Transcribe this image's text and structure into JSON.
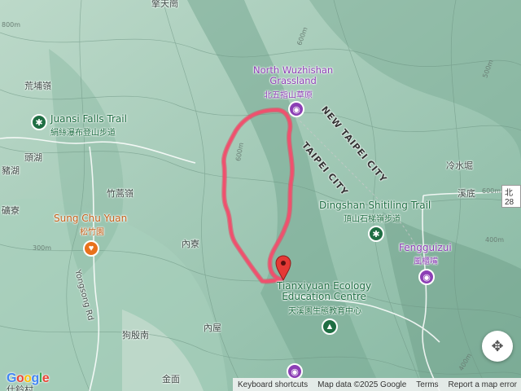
{
  "map": {
    "labels": {
      "top_place": "擎天崗",
      "huangpuling": "荒埔嶺",
      "toohu": "頭湖",
      "zhuhu": "豬湖",
      "lanliao": "礦寮",
      "zhugaoling": "竹蒿嶺",
      "neiliao": "內寮",
      "neiwu": "內屋",
      "gouyinan": "狗殷南",
      "jinmian": "金面",
      "lengshuikeng": "冷水堀",
      "xidi": "溪底",
      "yongsong_rd": "Yongsong Rd",
      "bottom_left": "仕鈴村"
    },
    "districts": {
      "new_taipei": "NEW TAIPEI CITY",
      "taipei": "TAIPEI CITY"
    },
    "pois": {
      "north_wuzhishan": {
        "en1": "North Wuzhishan",
        "en2": "Grassland",
        "zh": "北五指山草原",
        "icon": "camera-icon",
        "color": "#8c3fb5"
      },
      "juansi_falls": {
        "en": "Juansi Falls Trail",
        "zh": "絹絲瀑布登山步道",
        "icon": "hiker-icon",
        "color": "#1f6e43"
      },
      "sung_chu_yuan": {
        "en": "Sung Chu Yuan",
        "zh": "松竹園",
        "icon": "restaurant-icon",
        "color": "#c4611a"
      },
      "dingshan": {
        "en": "Dingshan Shitiling Trail",
        "zh": "頂山石梯嶺步道",
        "icon": "hiker-icon",
        "color": "#1f6e43"
      },
      "fengguizui": {
        "en": "Fengguizui",
        "zh": "風櫃嘴",
        "icon": "camera-icon",
        "color": "#8c3fb5"
      },
      "tianxiyuan": {
        "en1": "Tianxiyuan Ecology",
        "en2": "Education Centre",
        "zh": "天溪園生態教育中心",
        "icon": "tree-icon",
        "color": "#1f6e43"
      }
    },
    "road_badge": "北28",
    "contours": [
      "800m",
      "600m",
      "600m",
      "500m",
      "600m",
      "400m",
      "400m",
      "300m"
    ]
  },
  "attribution": {
    "keyboard": "Keyboard shortcuts",
    "data": "Map data ©2025 Google",
    "terms": "Terms",
    "report": "Report a map error"
  },
  "logo": "Google",
  "colors": {
    "route": "#f0506e",
    "marker": "#e53935",
    "terrain": "#9fc8b6"
  }
}
